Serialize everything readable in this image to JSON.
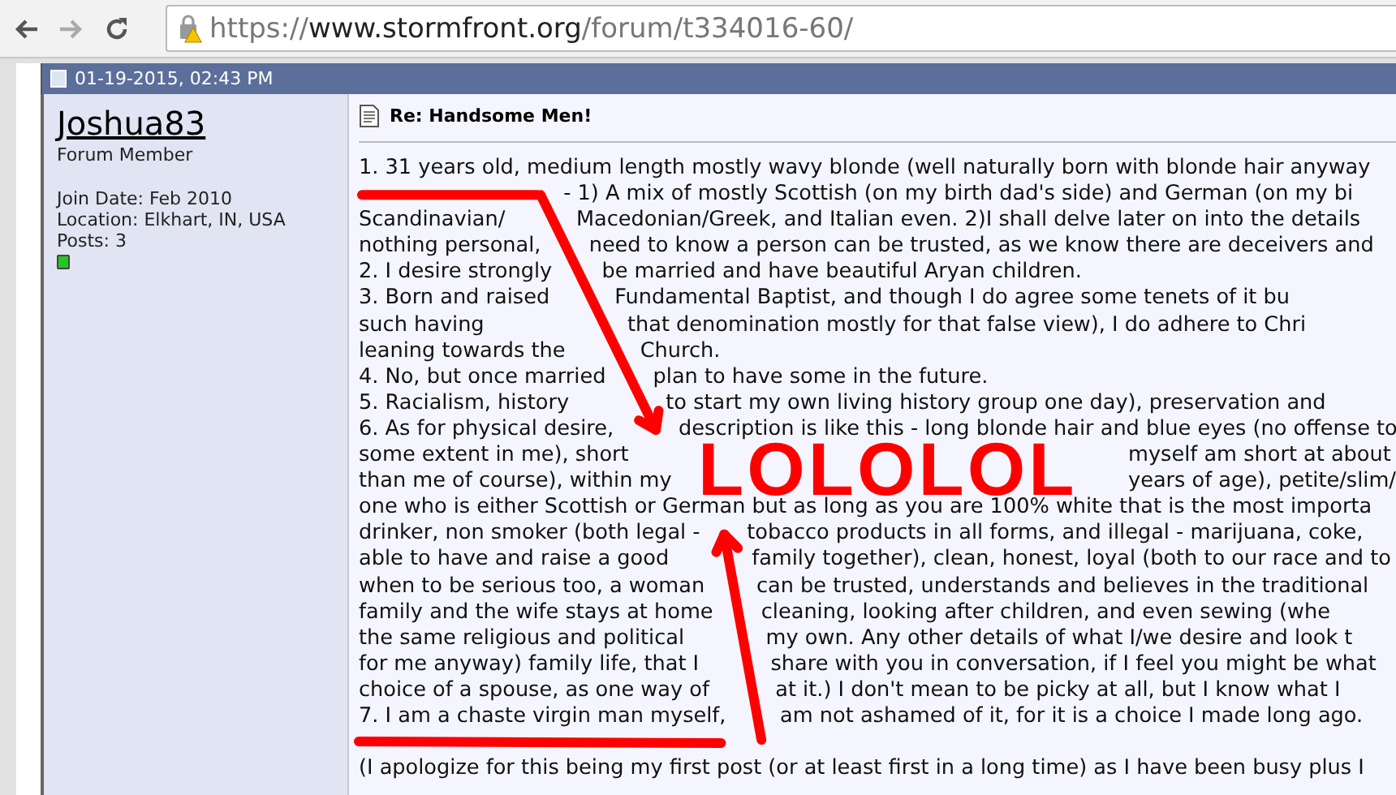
{
  "browser": {
    "url_scheme": "https://",
    "url_host": "www.stormfront.org",
    "url_path": "/forum/t334016-60/"
  },
  "post": {
    "date": "01-19-2015, 02:43 PM",
    "author": {
      "name": "Joshua83",
      "title": "Forum Member",
      "details": [
        "Join Date: Feb 2010",
        "Location: Elkhart, IN, USA",
        "Posts: 3"
      ],
      "online": true
    },
    "title": "Re: Handsome Men!",
    "paragraphs": [
      [
        {
          "kind": "full",
          "text": "1. 31 years old, medium length mostly wavy blonde (well naturally born with blonde hair anyway"
        },
        {
          "kind": "gap",
          "after": "- 1) A mix of mostly Scottish (on my birth dad's side) and German (on my bi"
        },
        {
          "kind": "gap",
          "before": "Scandinavian/",
          "after": "Macedonian/Greek, and Italian even. 2)I shall delve later on into the details"
        },
        {
          "kind": "gap",
          "before": "nothing personal,",
          "after": "need to know a person can be trusted, as we know there are deceivers and"
        },
        {
          "kind": "gap",
          "before": "2. I desire strongly",
          "after": "be married and have beautiful Aryan children."
        },
        {
          "kind": "gap",
          "before": "3. Born and raised",
          "after": "Fundamental Baptist, and though I do agree some tenets of it bu"
        },
        {
          "kind": "gap",
          "before": "such having",
          "after": "that denomination mostly for that false view), I do adhere to Chri"
        },
        {
          "kind": "gap",
          "before": "leaning towards the",
          "after": "Church."
        },
        {
          "kind": "gap",
          "before": "4. No, but once married",
          "after": "plan to have some in the future."
        },
        {
          "kind": "gap",
          "before": "5. Racialism, history",
          "after": "to start my own living history group one day), preservation and"
        },
        {
          "kind": "gap",
          "before": "6. As for physical desire,",
          "after": "description is like this - long blonde hair and blue eyes (no offense to"
        },
        {
          "kind": "split",
          "left": "some extent in me), short",
          "right": "myself am short at about"
        },
        {
          "kind": "split",
          "left": "than me of course), within my",
          "right": "years of age), petite/slim/"
        },
        {
          "kind": "full",
          "text": "one who is either Scottish or German but as long as you are 100% white that is the most importa"
        },
        {
          "kind": "gap",
          "before": "drinker, non smoker (both legal -",
          "after": "tobacco products in all forms, and illegal - marijuana, coke,"
        },
        {
          "kind": "gap",
          "before": "able to have and raise a good",
          "after": "family together), clean, honest, loyal (both to our race and to"
        },
        {
          "kind": "gap",
          "before": "when to be serious too, a woman",
          "after": "can be trusted, understands and believes in the traditional"
        },
        {
          "kind": "gap",
          "before": "family and the wife stays at home",
          "after": "cleaning, looking after children, and even sewing (whe"
        },
        {
          "kind": "gap",
          "before": "the same religious and political",
          "after": "my own. Any other details of what I/we desire and look t"
        },
        {
          "kind": "gap",
          "before": "for me anyway) family life, that I",
          "after": "share with you in conversation, if I feel you might be what"
        },
        {
          "kind": "gap",
          "before": "choice of a spouse, as one way of",
          "after": "at it.) I don't mean to be picky at all, but I know what I"
        },
        {
          "kind": "gap",
          "before": "7. I am a chaste virgin man myself,",
          "after": "am not ashamed of it, for it is a choice I made long ago."
        }
      ],
      [
        {
          "kind": "full",
          "text": "(I apologize for this being my first post (or at least first in a long time) as I have been busy plus I"
        }
      ]
    ]
  },
  "annotations": [
    {
      "kind": "underline"
    },
    {
      "kind": "arrow"
    },
    {
      "kind": "text",
      "text": "LOLOLOL"
    },
    {
      "kind": "arrow"
    },
    {
      "kind": "underline"
    }
  ]
}
